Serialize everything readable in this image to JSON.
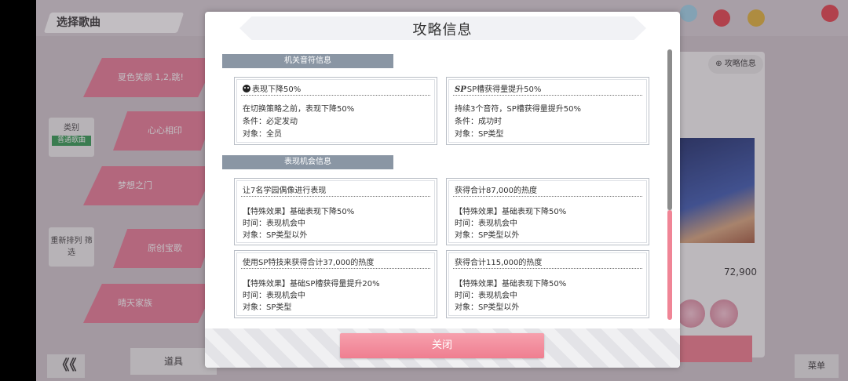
{
  "background": {
    "screen_title": "选择歌曲",
    "song_cards": [
      "夏色笑颜 1,2,跳!",
      "心心相印",
      "梦想之门",
      "原创宝歌",
      "晴天家族"
    ],
    "side_buttons": [
      {
        "label": "类别",
        "badge": "普通歌曲"
      },
      {
        "label": "重新排列 筛选",
        "badge": ""
      }
    ],
    "back_label": "《《",
    "items_label": "道具",
    "menu_label": "菜单",
    "strategy_label": "攻略信息",
    "score": "72,900"
  },
  "modal": {
    "title": "攻略信息",
    "sections": [
      {
        "label": "机关音符信息",
        "cards": [
          {
            "icon": "face-icon",
            "title": "表现下降50%",
            "lines": [
              "在切换策略之前，表现下降50%",
              "条件：必定发动",
              "对象：全员"
            ]
          },
          {
            "icon": "sp-icon",
            "icon_text": "SP",
            "title": "SP槽获得量提升50%",
            "lines": [
              "持续3个音符，SP槽获得量提升50%",
              "条件：成功时",
              "对象：SP类型"
            ]
          }
        ]
      },
      {
        "label": "表现机会信息",
        "cards": [
          {
            "title": "让7名学园偶像进行表现",
            "lines": [
              "【特殊效果】基础表现下降50%",
              "时间：表现机会中",
              "对象：SP类型以外"
            ]
          },
          {
            "title": "获得合计87,000的热度",
            "lines": [
              "【特殊效果】基础表现下降50%",
              "时间：表现机会中",
              "对象：SP类型以外"
            ]
          },
          {
            "title": "使用SP特技来获得合计37,000的热度",
            "lines": [
              "【特殊效果】基础SP槽获得量提升20%",
              "时间：表现机会中",
              "对象：SP类型"
            ]
          },
          {
            "title": "获得合计115,000的热度",
            "lines": [
              "【特殊效果】基础表现下降50%",
              "时间：表现机会中",
              "对象：SP类型以外"
            ]
          }
        ]
      }
    ],
    "close_label": "关闭"
  },
  "colors": {
    "accent": "#f08596",
    "section_bar": "#8a96a4",
    "song_card": "#e87a96"
  }
}
